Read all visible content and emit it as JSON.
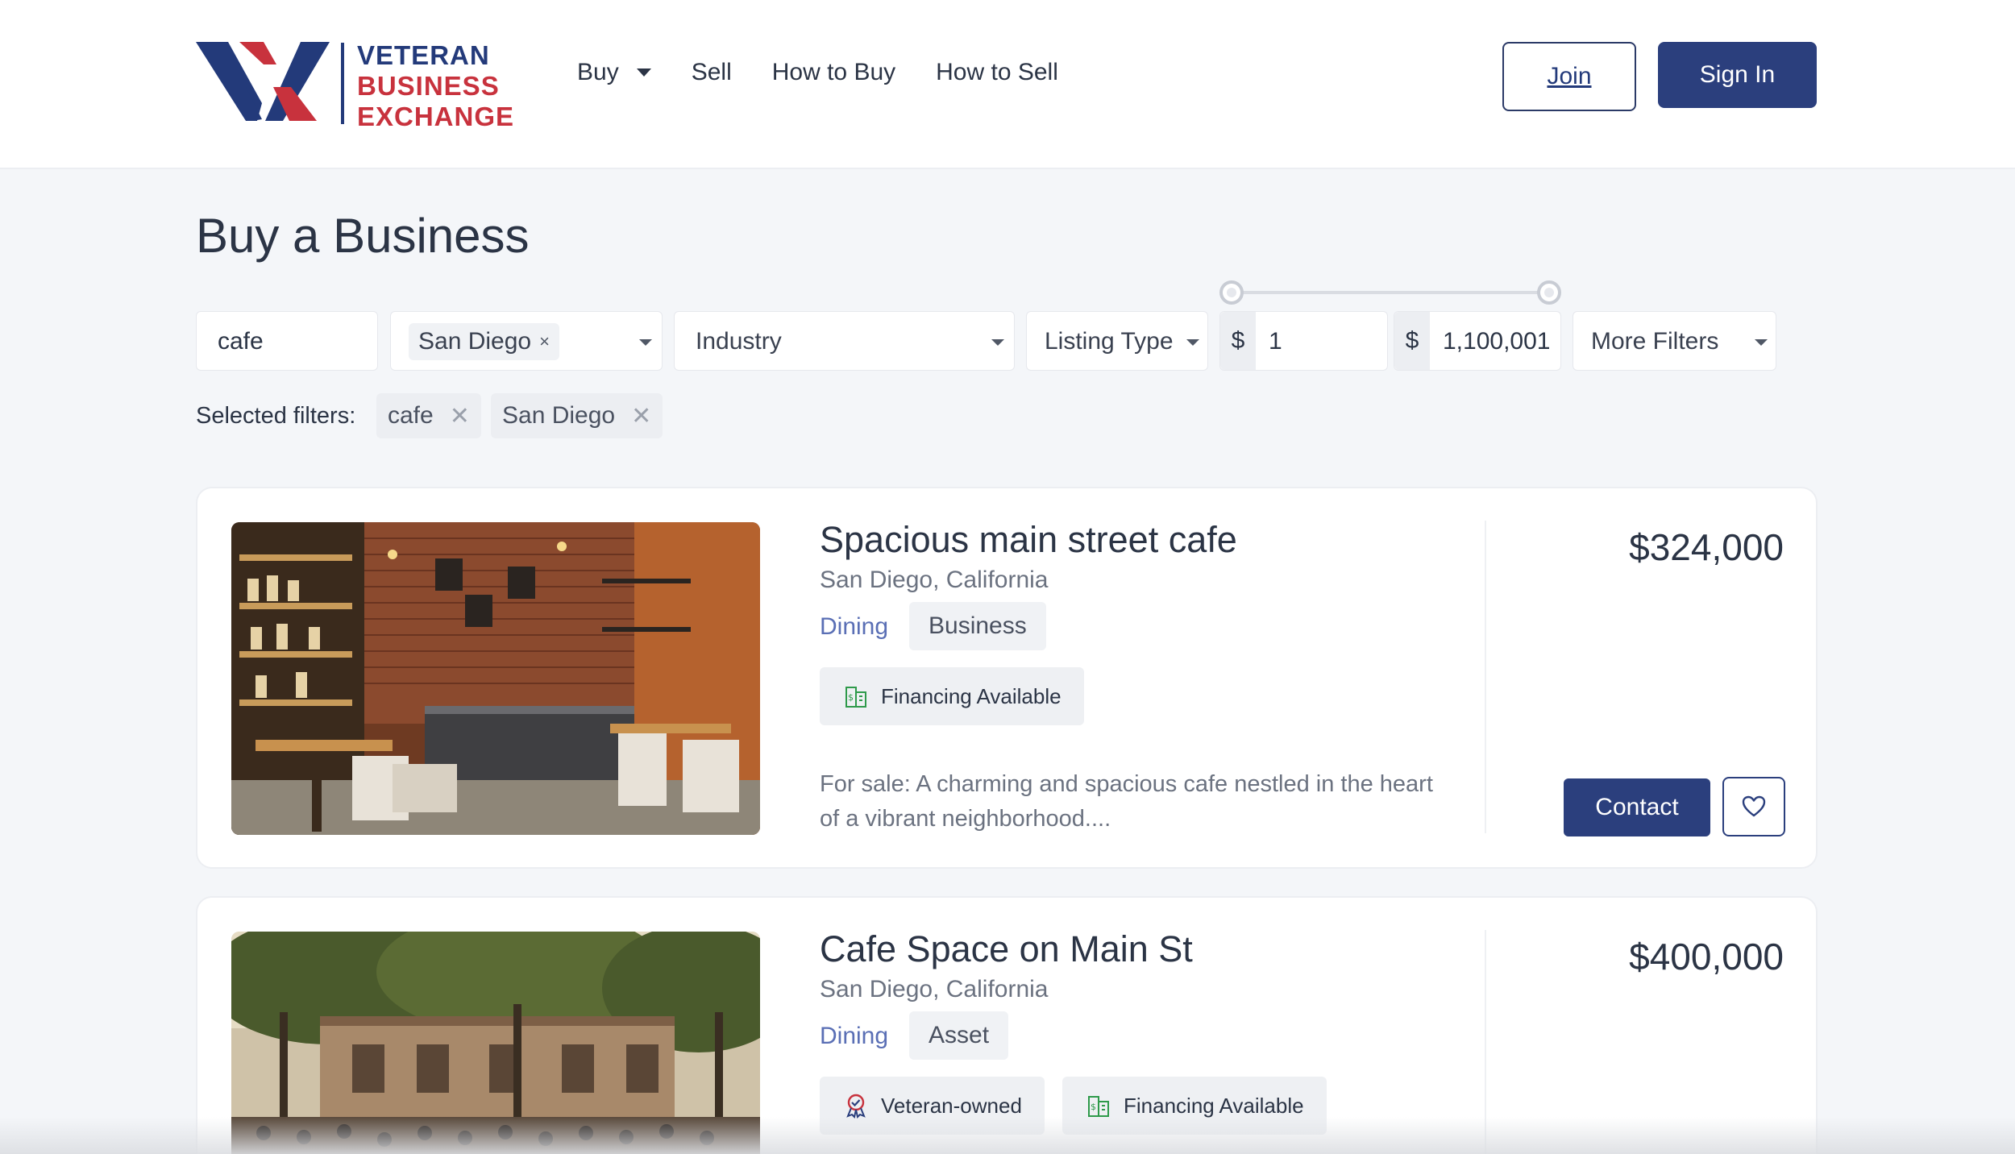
{
  "brand": {
    "line1": "VETERAN",
    "line2": "BUSINESS",
    "line3": "EXCHANGE",
    "colors": {
      "navy": "#233a7a",
      "red": "#c8323d"
    }
  },
  "nav": {
    "items": [
      {
        "label": "Buy",
        "has_dropdown": true
      },
      {
        "label": "Sell"
      },
      {
        "label": "How to Buy"
      },
      {
        "label": "How to Sell"
      }
    ],
    "join_label": "Join",
    "signin_label": "Sign In"
  },
  "page_title": "Buy a Business",
  "filters": {
    "keyword": "cafe",
    "location_chip": "San Diego",
    "location_chip_remove": "×",
    "industry_placeholder": "Industry",
    "listing_type_placeholder": "Listing Type",
    "currency_symbol": "$",
    "price_min": "1",
    "price_max": "1,100,001",
    "more_filters": "More Filters"
  },
  "selected_filters": {
    "label": "Selected filters:",
    "chips": [
      "cafe",
      "San Diego"
    ],
    "remove_symbol": "✕"
  },
  "listings": [
    {
      "title": "Spacious main street cafe",
      "location": "San Diego, California",
      "industry": "Dining",
      "type": "Business",
      "badges": [
        "Financing Available"
      ],
      "description": "For sale: A charming and spacious cafe nestled in the heart of a vibrant neighborhood....",
      "price": "$324,000",
      "contact_label": "Contact",
      "image": "cafe-interior-photo"
    },
    {
      "title": "Cafe Space on Main St",
      "location": "San Diego, California",
      "industry": "Dining",
      "type": "Asset",
      "badges": [
        "Veteran-owned",
        "Financing Available"
      ],
      "price": "$400,000",
      "image": "outdoor-plaza-photo"
    }
  ],
  "icons": {
    "financing": "financing-building-icon",
    "veteran": "veteran-ribbon-icon",
    "favorite": "heart-icon"
  },
  "accent_colors": {
    "primary_button": "#2b3f7d",
    "industry_link": "#5a6fb5",
    "financing_icon": "#2e9a4a",
    "veteran_icon": "#c8323d"
  }
}
